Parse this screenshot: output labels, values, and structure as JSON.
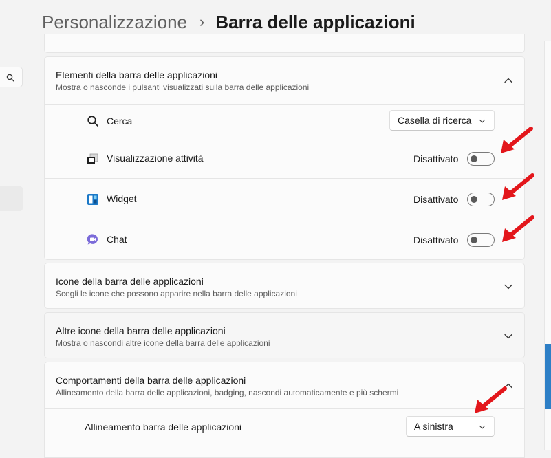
{
  "breadcrumb": {
    "parent": "Personalizzazione",
    "separator": "›",
    "current": "Barra delle applicazioni"
  },
  "sections": {
    "taskbar_items": {
      "title": "Elementi della barra delle applicazioni",
      "subtitle": "Mostra o nasconde i pulsanti visualizzati sulla barra delle applicazioni",
      "expanded": true,
      "search": {
        "label": "Cerca",
        "dropdown_value": "Casella di ricerca",
        "icon": "search-icon"
      },
      "task_view": {
        "label": "Visualizzazione attività",
        "state": "Disattivato",
        "on": false,
        "icon": "task-view-icon"
      },
      "widgets": {
        "label": "Widget",
        "state": "Disattivato",
        "on": false,
        "icon": "widgets-icon"
      },
      "chat": {
        "label": "Chat",
        "state": "Disattivato",
        "on": false,
        "icon": "chat-icon"
      }
    },
    "taskbar_icons": {
      "title": "Icone della barra delle applicazioni",
      "subtitle": "Scegli le icone che possono apparire nella barra delle applicazioni",
      "expanded": false
    },
    "other_icons": {
      "title": "Altre icone della barra delle applicazioni",
      "subtitle": "Mostra o nascondi altre icone della barra delle applicazioni",
      "expanded": false
    },
    "behaviors": {
      "title": "Comportamenti della barra delle applicazioni",
      "subtitle": "Allineamento della barra delle applicazioni, badging, nascondi automaticamente e più schermi",
      "expanded": true,
      "alignment": {
        "label": "Allineamento barra delle applicazioni",
        "dropdown_value": "A sinistra"
      }
    }
  },
  "colors": {
    "annotation_arrow": "#e3161b",
    "accent": "#2d7fc6"
  }
}
